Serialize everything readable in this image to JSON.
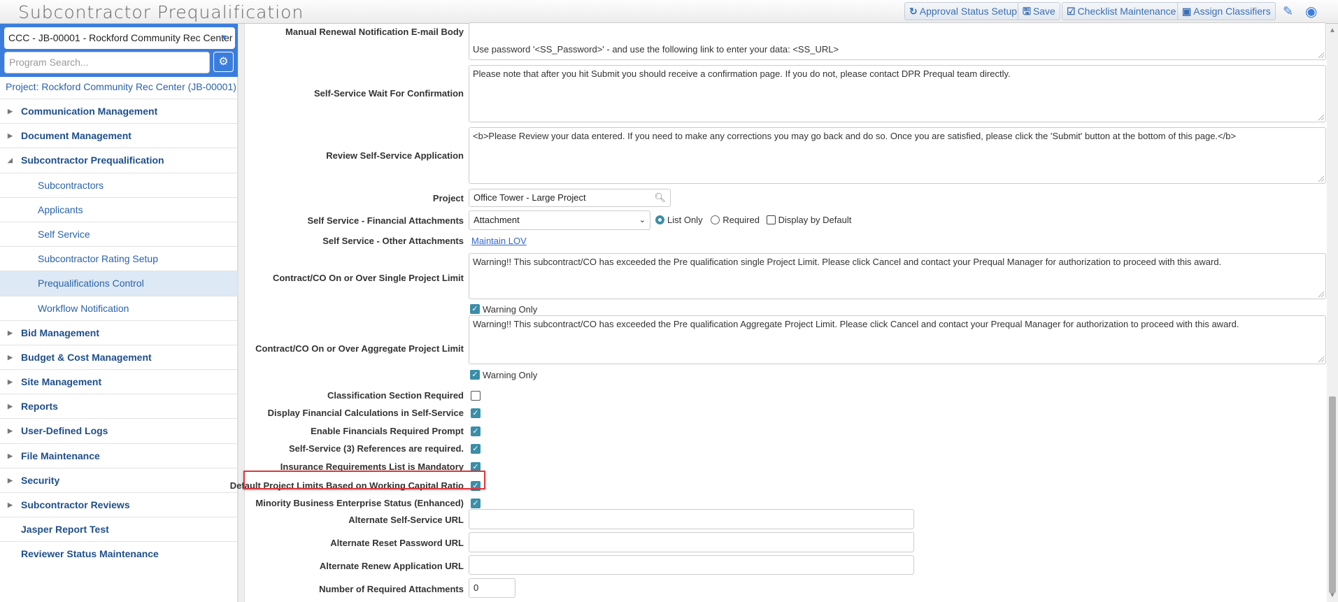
{
  "header": {
    "title": "Subcontractor Prequalification",
    "buttons": [
      {
        "icon": "↻",
        "label": "Approval Status Setup"
      },
      {
        "icon": "🖫",
        "label": "Save"
      },
      {
        "icon": "☑",
        "label": "Checklist Maintenance"
      },
      {
        "icon": "▣",
        "label": "Assign Classifiers"
      }
    ]
  },
  "sidebar": {
    "project_select": "CCC - JB-00001 - Rockford Community Rec Center",
    "search_placeholder": "Program Search...",
    "project_link": "Project: Rockford Community Rec Center (JB-00001)",
    "items": [
      {
        "label": "Communication Management",
        "type": "group"
      },
      {
        "label": "Document Management",
        "type": "group"
      },
      {
        "label": "Subcontractor Prequalification",
        "type": "open"
      },
      {
        "label": "Subcontractors",
        "type": "sub"
      },
      {
        "label": "Applicants",
        "type": "sub"
      },
      {
        "label": "Self Service",
        "type": "sub"
      },
      {
        "label": "Subcontractor Rating Setup",
        "type": "sub"
      },
      {
        "label": "Prequalifications Control",
        "type": "sub",
        "active": true
      },
      {
        "label": "Workflow Notification",
        "type": "sub"
      },
      {
        "label": "Bid Management",
        "type": "group"
      },
      {
        "label": "Budget & Cost Management",
        "type": "group"
      },
      {
        "label": "Site Management",
        "type": "group"
      },
      {
        "label": "Reports",
        "type": "group"
      },
      {
        "label": "User-Defined Logs",
        "type": "group"
      },
      {
        "label": "File Maintenance",
        "type": "group"
      },
      {
        "label": "Security",
        "type": "group"
      },
      {
        "label": "Subcontractor Reviews",
        "type": "group"
      },
      {
        "label": "Jasper Report Test",
        "type": "leaf"
      },
      {
        "label": "Reviewer Status Maintenance",
        "type": "leaf"
      }
    ]
  },
  "form": {
    "manual_renewal": {
      "label": "Manual Renewal Notification E-mail Body",
      "value": "Use password '<SS_Password>' - and use the following link to enter your data: <SS_URL>"
    },
    "wait_confirmation": {
      "label": "Self-Service Wait For Confirmation",
      "value": "Please note that after you hit Submit you should receive a confirmation page.  If you do not, please contact DPR Prequal team directly."
    },
    "review_app": {
      "label": "Review Self-Service Application",
      "value": "<b>Please Review your data entered.  If you need to make any corrections you may go back and do so.  Once you are satisfied, please click the 'Submit' button at the bottom of this page.</b>"
    },
    "project": {
      "label": "Project",
      "value": "Office Tower - Large Project"
    },
    "financial_attachments": {
      "label": "Self Service - Financial Attachments",
      "value": "Attachment",
      "list_only": "List Only",
      "required": "Required",
      "display_default": "Display by Default"
    },
    "other_attachments": {
      "label": "Self Service - Other Attachments",
      "link": "Maintain LOV"
    },
    "single_limit": {
      "label": "Contract/CO On or Over Single Project Limit",
      "value": "Warning!! This subcontract/CO has exceeded the Pre qualification single Project Limit. Please click Cancel and contact your Prequal Manager for authorization to proceed with this award.",
      "warning_only": "Warning Only"
    },
    "aggregate_limit": {
      "label": "Contract/CO On or Over Aggregate Project Limit",
      "value": "Warning!! This subcontract/CO has exceeded the Pre qualification Aggregate Project Limit. Please click Cancel and contact your Prequal Manager for authorization to proceed with this award.",
      "warning_only": "Warning Only"
    },
    "checkboxes": [
      {
        "label": "Classification Section Required",
        "checked": false
      },
      {
        "label": "Display Financial Calculations in Self-Service",
        "checked": true
      },
      {
        "label": "Enable Financials Required Prompt",
        "checked": true
      },
      {
        "label": "Self-Service (3) References are required.",
        "checked": true
      },
      {
        "label": "Insurance Requirements List is Mandatory",
        "checked": true
      },
      {
        "label": "Default Project Limits Based on Working Capital Ratio",
        "checked": true
      },
      {
        "label": "Minority Business Enterprise Status (Enhanced)",
        "checked": true
      }
    ],
    "alt_ss_url": {
      "label": "Alternate Self-Service URL",
      "value": ""
    },
    "alt_reset_url": {
      "label": "Alternate Reset Password URL",
      "value": ""
    },
    "alt_renew_url": {
      "label": "Alternate Renew Application URL",
      "value": ""
    },
    "num_attachments": {
      "label": "Number of Required Attachments",
      "value": "0"
    }
  }
}
